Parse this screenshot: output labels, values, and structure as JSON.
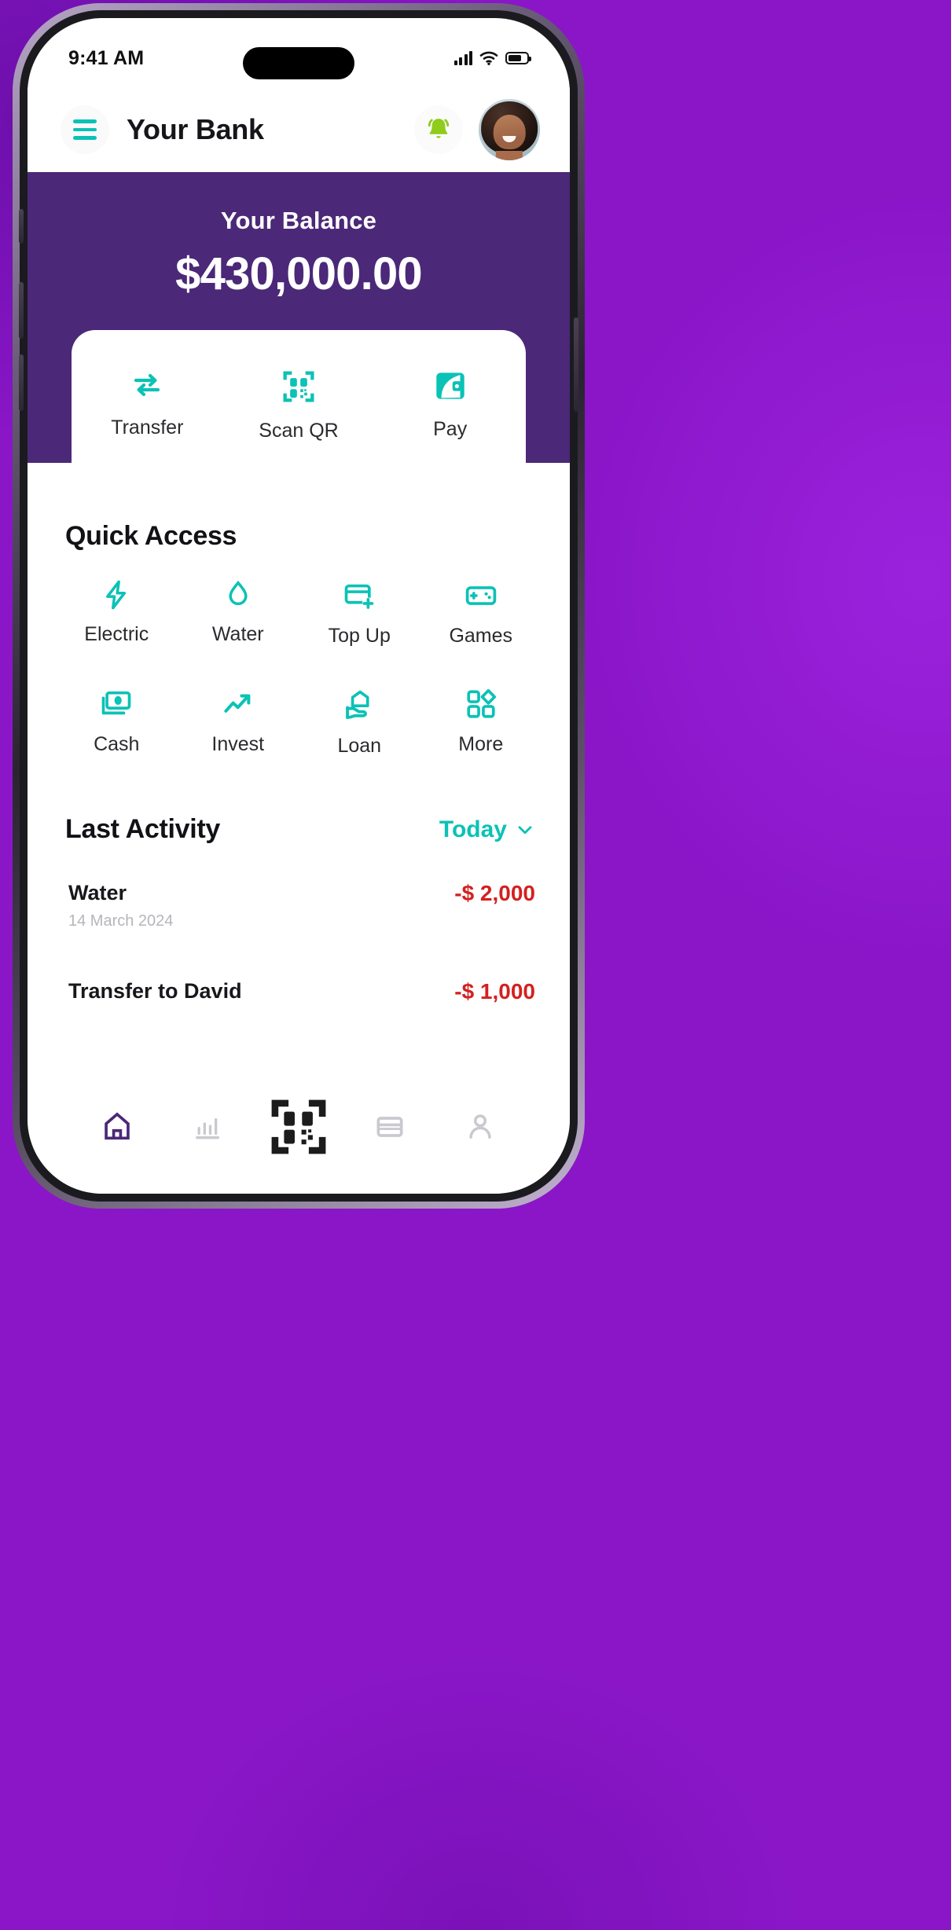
{
  "colors": {
    "brand_purple": "#4B2878",
    "accent_teal": "#0BC2B6",
    "bell_green": "#8FCC1B",
    "negative_red": "#D42020",
    "page_background": "#8A16C8"
  },
  "status_bar": {
    "time": "9:41 AM",
    "cellular_icon": "cellular-signal-icon",
    "wifi_icon": "wifi-icon",
    "battery_icon": "battery-icon"
  },
  "header": {
    "menu_icon": "hamburger-menu-icon",
    "title": "Your Bank",
    "notification_icon": "bell-icon",
    "avatar_alt": "user-avatar"
  },
  "balance": {
    "label": "Your Balance",
    "amount": "$430,000.00"
  },
  "actions": [
    {
      "label": "Transfer",
      "icon": "transfer-arrows-icon"
    },
    {
      "label": "Scan QR",
      "icon": "qr-code-icon"
    },
    {
      "label": "Pay",
      "icon": "wallet-pay-icon"
    }
  ],
  "quick_access": {
    "title": "Quick Access",
    "items": [
      {
        "label": "Electric",
        "icon": "lightning-bolt-icon"
      },
      {
        "label": "Water",
        "icon": "water-drop-icon"
      },
      {
        "label": "Top Up",
        "icon": "card-plus-icon"
      },
      {
        "label": "Games",
        "icon": "gamepad-icon"
      },
      {
        "label": "Cash",
        "icon": "banknote-icon"
      },
      {
        "label": "Invest",
        "icon": "trending-up-icon"
      },
      {
        "label": "Loan",
        "icon": "house-in-hand-icon"
      },
      {
        "label": "More",
        "icon": "grid-more-icon"
      }
    ]
  },
  "last_activity": {
    "title": "Last Activity",
    "filter_label": "Today",
    "filter_icon": "chevron-down-icon",
    "transactions": [
      {
        "name": "Water",
        "date": "14 March 2024",
        "amount": "-$ 2,000"
      },
      {
        "name": "Transfer to David",
        "date": "",
        "amount": "-$ 1,000"
      }
    ]
  },
  "bottom_nav": [
    {
      "icon": "home-icon",
      "active": true
    },
    {
      "icon": "bar-chart-icon",
      "active": false
    },
    {
      "icon": "qr-scan-icon",
      "active": false
    },
    {
      "icon": "card-icon",
      "active": false
    },
    {
      "icon": "profile-icon",
      "active": false
    }
  ]
}
